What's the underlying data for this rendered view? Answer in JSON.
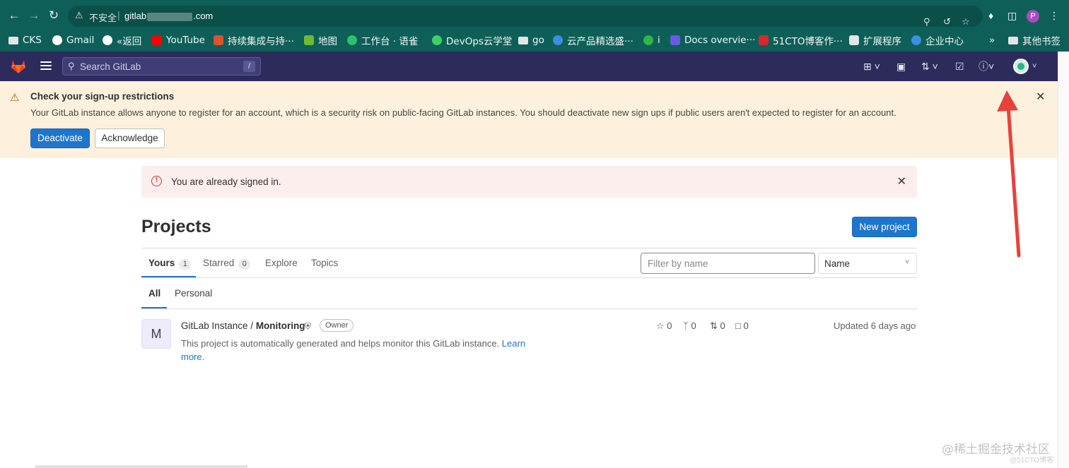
{
  "browser": {
    "security_label": "不安全",
    "url_start": "gitlab",
    "url_end": ".com",
    "profile_initial": "P",
    "bookmarks": [
      "CKS",
      "Gmail",
      "«返回",
      "YouTube",
      "持续集成与持···",
      "地图",
      "工作台 · 语雀",
      "DevOps云学堂",
      "go",
      "云产品精选盛···",
      "i",
      "Docs overvie···",
      "51CTO博客作···",
      "扩展程序",
      "企业中心"
    ],
    "more_bookmarks_label": "»",
    "other_bookmarks": "其他书签"
  },
  "gitlab_nav": {
    "search_placeholder": "Search GitLab",
    "search_shortcut": "/"
  },
  "banner": {
    "title": "Check your sign-up restrictions",
    "text": "Your GitLab instance allows anyone to register for an account, which is a security risk on public-facing GitLab instances. You should deactivate new sign ups if public users aren't expected to register for an account.",
    "deactivate_label": "Deactivate",
    "acknowledge_label": "Acknowledge"
  },
  "signed_in_alert": {
    "text": "You are already signed in."
  },
  "page": {
    "title": "Projects",
    "new_project_label": "New project"
  },
  "tabs": {
    "yours": {
      "label": "Yours",
      "count": "1"
    },
    "starred": {
      "label": "Starred",
      "count": "0"
    },
    "explore": {
      "label": "Explore"
    },
    "topics": {
      "label": "Topics"
    }
  },
  "filter": {
    "placeholder": "Filter by name",
    "sort_value": "Name"
  },
  "subtabs": {
    "all": "All",
    "personal": "Personal"
  },
  "project": {
    "avatar_letter": "M",
    "namespace": "GitLab Instance / ",
    "name": "Monitoring",
    "role_badge": "Owner",
    "description": "This project is automatically generated and helps monitor this GitLab instance. ",
    "learn_more": "Learn more",
    "description_end": ".",
    "stars": "0",
    "forks": "0",
    "merge_requests": "0",
    "issues": "0",
    "updated": "Updated 6 days ago"
  },
  "watermark": {
    "line1": "@稀土掘金技术社区",
    "line2": "@51CTO博客"
  },
  "colors": {
    "chrome": "#0e5f58",
    "gitlab_nav": "#2d2a5c",
    "banner_bg": "#fdf1dd",
    "error_bg": "#fdeeee",
    "primary": "#1f75cb",
    "annotation_arrow": "#e8413c"
  }
}
